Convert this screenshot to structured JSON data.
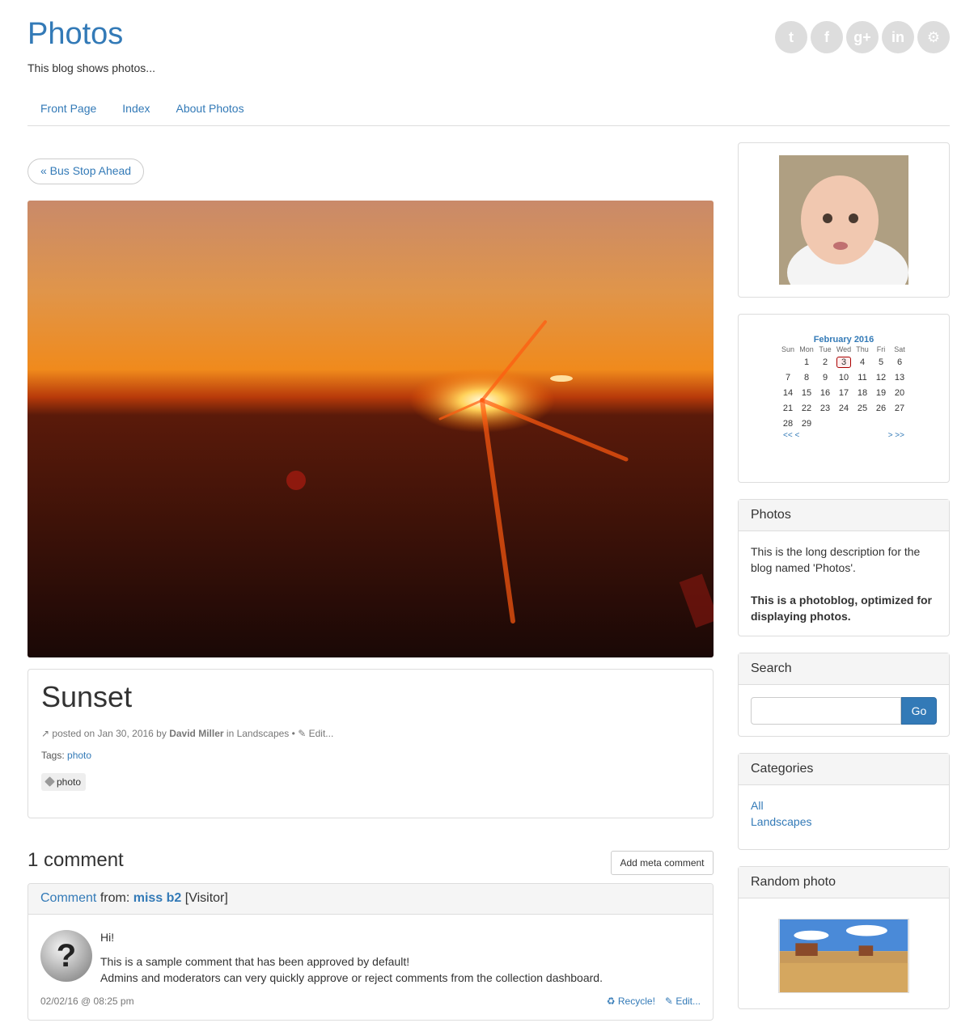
{
  "site": {
    "title": "Photos",
    "tagline": "This blog shows photos..."
  },
  "social": [
    {
      "icon": "twitter-icon",
      "glyph": "t"
    },
    {
      "icon": "facebook-icon",
      "glyph": "f"
    },
    {
      "icon": "google-plus-icon",
      "glyph": "g+"
    },
    {
      "icon": "linkedin-icon",
      "glyph": "in"
    },
    {
      "icon": "github-icon",
      "glyph": "⚙"
    }
  ],
  "nav": [
    "Front Page",
    "Index",
    "About Photos"
  ],
  "prev_link": "« Bus Stop Ahead",
  "post": {
    "title": "Sunset",
    "meta_prefix": "posted on Jan 30, 2016 by",
    "author": "David Miller",
    "meta_in": "in Landscapes •",
    "edit": "Edit...",
    "tags_label": "Tags:",
    "tags_link": "photo",
    "tag_chip": "photo"
  },
  "comments": {
    "heading": "1 comment",
    "add_meta": "Add meta comment",
    "item": {
      "head_link": "Comment",
      "head_from": "from:",
      "author": "miss b2",
      "role": "[Visitor]",
      "avatar_glyph": "?",
      "lines": [
        "Hi!",
        "This is a sample comment that has been approved by default!",
        "Admins and moderators can very quickly approve or reject comments from the collection dashboard."
      ],
      "date": "02/02/16 @ 08:25 pm",
      "recycle": "Recycle!",
      "edit": "Edit..."
    }
  },
  "sidebar": {
    "calendar": {
      "title": "February 2016",
      "days": [
        "Sun",
        "Mon",
        "Tue",
        "Wed",
        "Thu",
        "Fri",
        "Sat"
      ],
      "weeks": [
        [
          "",
          "1",
          "2",
          "3",
          "4",
          "5",
          "6"
        ],
        [
          "7",
          "8",
          "9",
          "10",
          "11",
          "12",
          "13"
        ],
        [
          "14",
          "15",
          "16",
          "17",
          "18",
          "19",
          "20"
        ],
        [
          "21",
          "22",
          "23",
          "24",
          "25",
          "26",
          "27"
        ],
        [
          "28",
          "29",
          "",
          "",
          "",
          "",
          ""
        ]
      ],
      "today": "3",
      "nav_prev": "<<  <",
      "nav_next": ">  >>"
    },
    "blog_panel": {
      "title": "Photos",
      "desc": "This is the long description for the blog named 'Photos'.",
      "bold": "This is a photoblog, optimized for displaying photos."
    },
    "search": {
      "title": "Search",
      "button": "Go"
    },
    "categories": {
      "title": "Categories",
      "items": [
        "All",
        "Landscapes"
      ]
    },
    "random": {
      "title": "Random photo"
    }
  },
  "colors": {
    "link": "#337ab7",
    "accent_button": "#337ab7"
  }
}
